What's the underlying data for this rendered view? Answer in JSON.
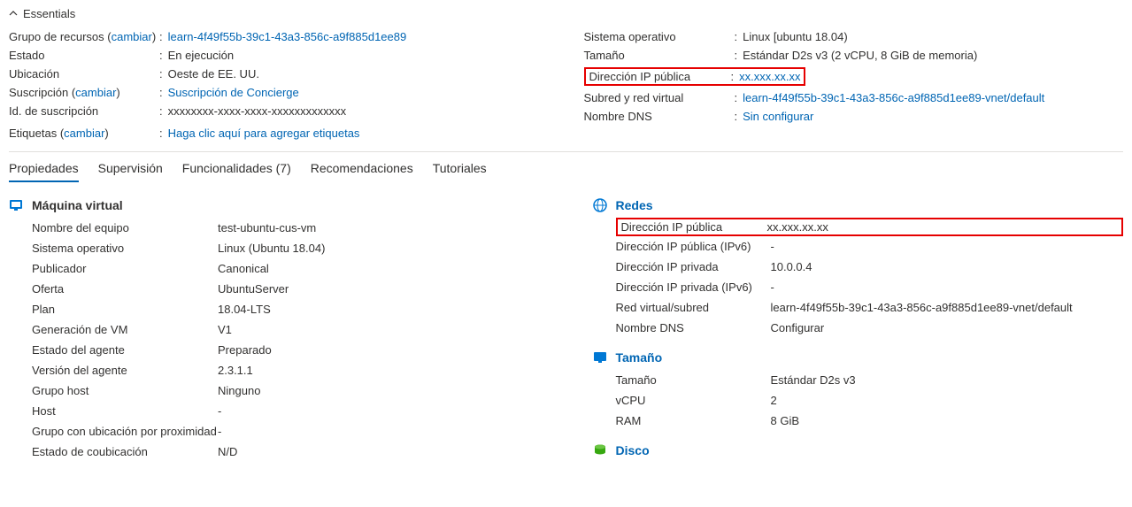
{
  "essentials": {
    "title": "Essentials",
    "left": {
      "resourceGroup": {
        "label": "Grupo de recursos",
        "change": "cambiar",
        "value": "learn-4f49f55b-39c1-43a3-856c-a9f885d1ee89"
      },
      "status": {
        "label": "Estado",
        "value": "En ejecución"
      },
      "location": {
        "label": "Ubicación",
        "value": "Oeste de EE. UU."
      },
      "subscription": {
        "label": "Suscripción",
        "change": "cambiar",
        "value": "Suscripción de Concierge"
      },
      "subscriptionId": {
        "label": "Id. de suscripción",
        "value": "xxxxxxxx-xxxx-xxxx-xxxxxxxxxxxxx"
      },
      "tags": {
        "label": "Etiquetas",
        "change": "cambiar",
        "value": "Haga clic aquí para agregar etiquetas"
      }
    },
    "right": {
      "os": {
        "label": "Sistema operativo",
        "value": "Linux [ubuntu 18.04)"
      },
      "size": {
        "label": "Tamaño",
        "value": "Estándar D2s v3 (2 vCPU, 8 GiB de memoria)"
      },
      "publicIp": {
        "label": "Dirección IP pública",
        "value": "xx.xxx.xx.xx"
      },
      "subnetVnet": {
        "label": "Subred y red virtual",
        "value": "learn-4f49f55b-39c1-43a3-856c-a9f885d1ee89-vnet/default"
      },
      "dns": {
        "label": "Nombre DNS",
        "value": "Sin configurar"
      }
    }
  },
  "tabs": {
    "properties": "Propiedades",
    "monitoring": "Supervisión",
    "capabilities": "Funcionalidades (7)",
    "recommendations": "Recomendaciones",
    "tutorials": "Tutoriales"
  },
  "vmSection": {
    "title": "Máquina virtual",
    "rows": {
      "computerName": {
        "label": "Nombre del equipo",
        "value": "test-ubuntu-cus-vm"
      },
      "os": {
        "label": "Sistema operativo",
        "value": "Linux (Ubuntu 18.04)"
      },
      "publisher": {
        "label": "Publicador",
        "value": "Canonical"
      },
      "offer": {
        "label": "Oferta",
        "value": "UbuntuServer"
      },
      "plan": {
        "label": "Plan",
        "value": "18.04-LTS"
      },
      "vmGen": {
        "label": "Generación de VM",
        "value": "V1"
      },
      "agentState": {
        "label": "Estado del agente",
        "value": "Preparado"
      },
      "agentVersion": {
        "label": "Versión del agente",
        "value": "2.3.1.1"
      },
      "hostGroup": {
        "label": "Grupo host",
        "value": "Ninguno"
      },
      "host": {
        "label": "Host",
        "value": "-"
      },
      "proximityGroup": {
        "label": "Grupo con ubicación por proximidad",
        "value": "-"
      },
      "colocationStatus": {
        "label": "Estado de coubicación",
        "value": "N/D"
      }
    }
  },
  "networkSection": {
    "title": "Redes",
    "rows": {
      "publicIp": {
        "label": "Dirección IP pública",
        "value": "xx.xxx.xx.xx"
      },
      "publicIpV6": {
        "label": "Dirección IP pública (IPv6)",
        "value": "-"
      },
      "privateIp": {
        "label": "Dirección IP privada",
        "value": "10.0.0.4"
      },
      "privateIpV6": {
        "label": "Dirección IP privada (IPv6)",
        "value": "-"
      },
      "vnetSubnet": {
        "label": "Red virtual/subred",
        "value": "learn-4f49f55b-39c1-43a3-856c-a9f885d1ee89-vnet/default"
      },
      "dns": {
        "label": "Nombre DNS",
        "value": "Configurar"
      }
    }
  },
  "sizeSection": {
    "title": "Tamaño",
    "rows": {
      "size": {
        "label": "Tamaño",
        "value": "Estándar D2s v3"
      },
      "vcpu": {
        "label": "vCPU",
        "value": "2"
      },
      "ram": {
        "label": "RAM",
        "value": "8 GiB"
      }
    }
  },
  "diskSection": {
    "title": "Disco"
  }
}
